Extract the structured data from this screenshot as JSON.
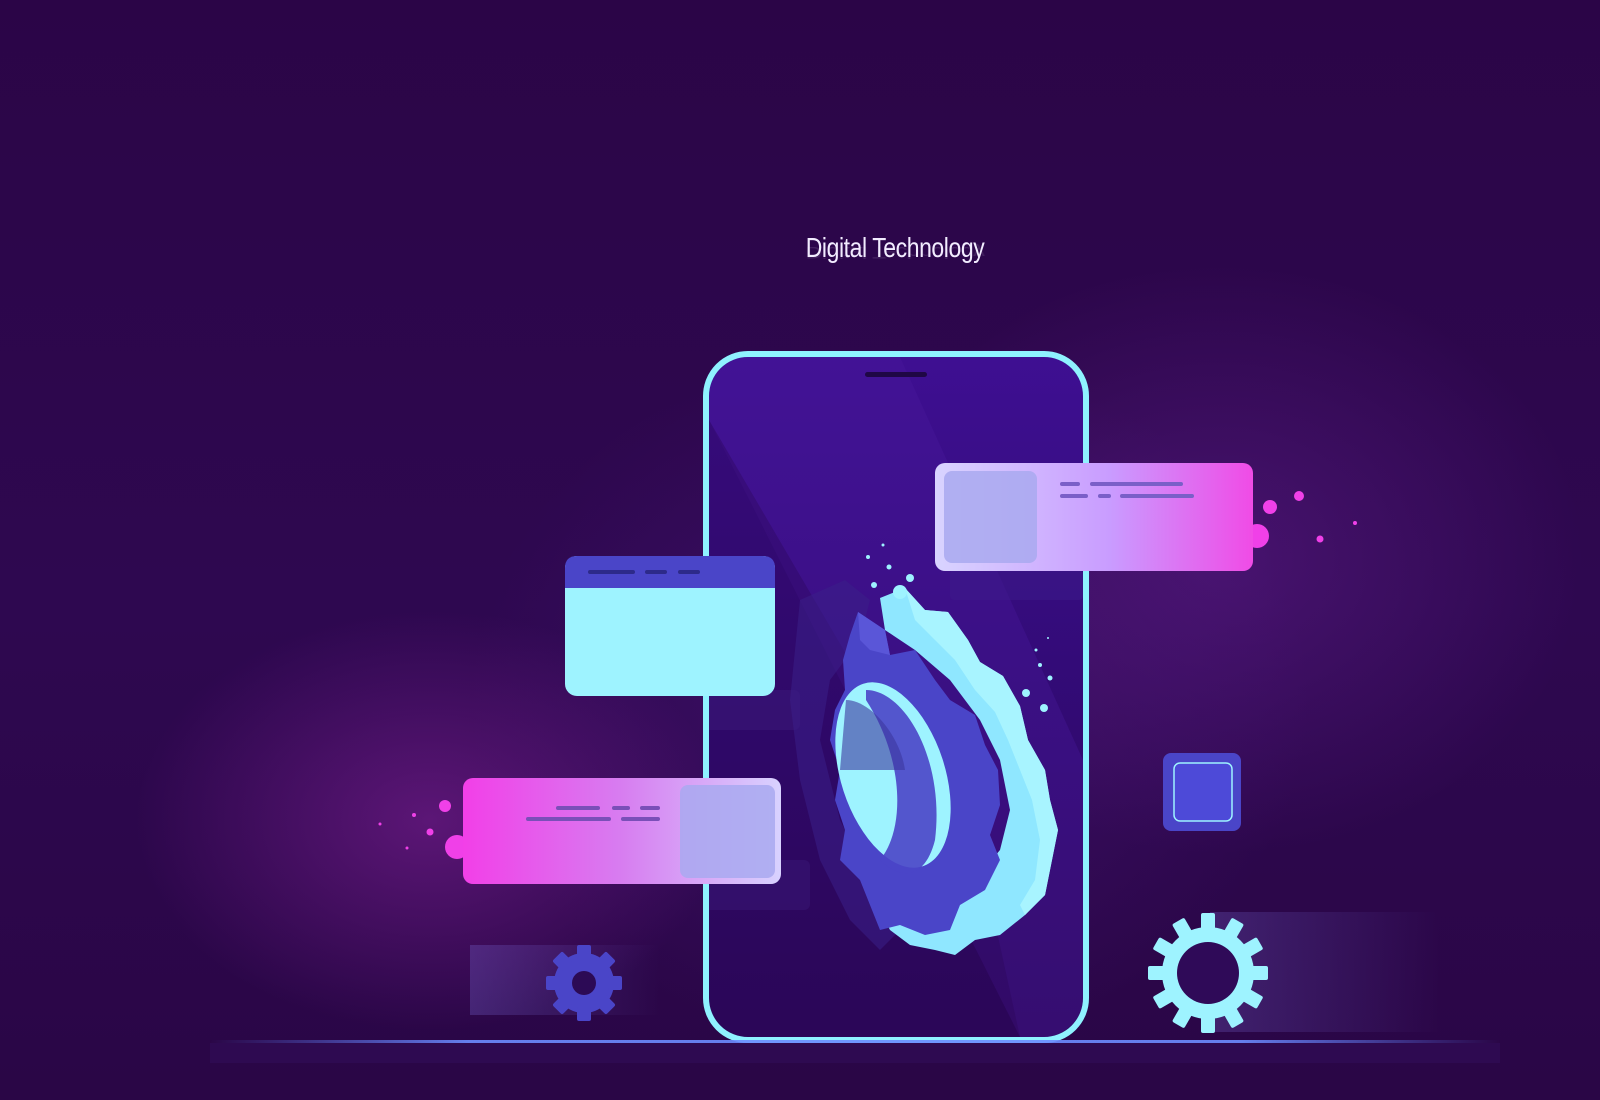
{
  "hero": {
    "title": "Digital Technology"
  },
  "palette": {
    "background": "#2c0748",
    "phone_outline": "#8ff2ff",
    "cyan": "#9ef3ff",
    "indigo": "#4a45c8",
    "magenta": "#f040e8"
  },
  "icons": [
    "smartphone-icon",
    "gear-icon",
    "chat-bubble-icon",
    "browser-window-icon",
    "square-chip-icon"
  ]
}
